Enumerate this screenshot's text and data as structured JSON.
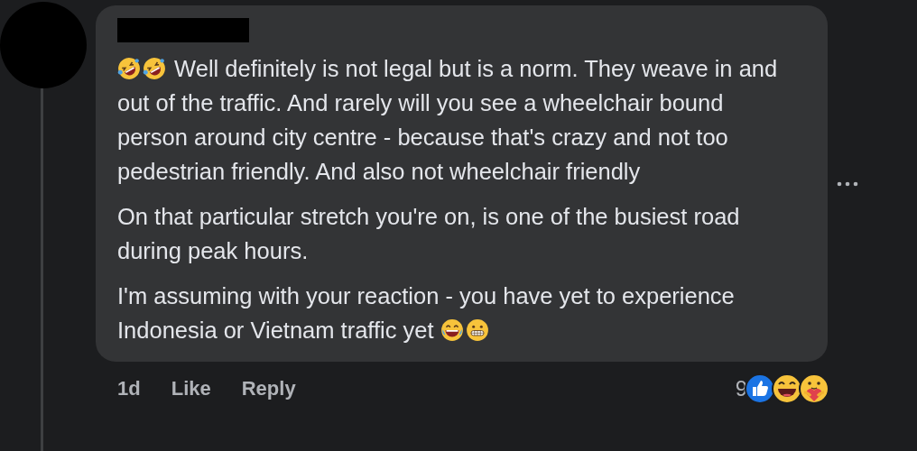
{
  "comment": {
    "paragraphs": [
      {
        "text": "Well definitely is not legal but is a norm. They weave in and out of the traffic. And rarely will you see a wheelchair bound person around city centre - because that's crazy and not too pedestrian friendly. And also not wheelchair friendly"
      },
      {
        "text": "On that particular stretch you're on, is one of the busiest road during peak hours."
      },
      {
        "text": "I'm assuming with your reaction - you have yet to experience Indonesia or Vietnam traffic yet"
      }
    ],
    "time": "1d",
    "actions": [
      "Like",
      "Reply"
    ],
    "reactions": {
      "count": "9"
    }
  }
}
